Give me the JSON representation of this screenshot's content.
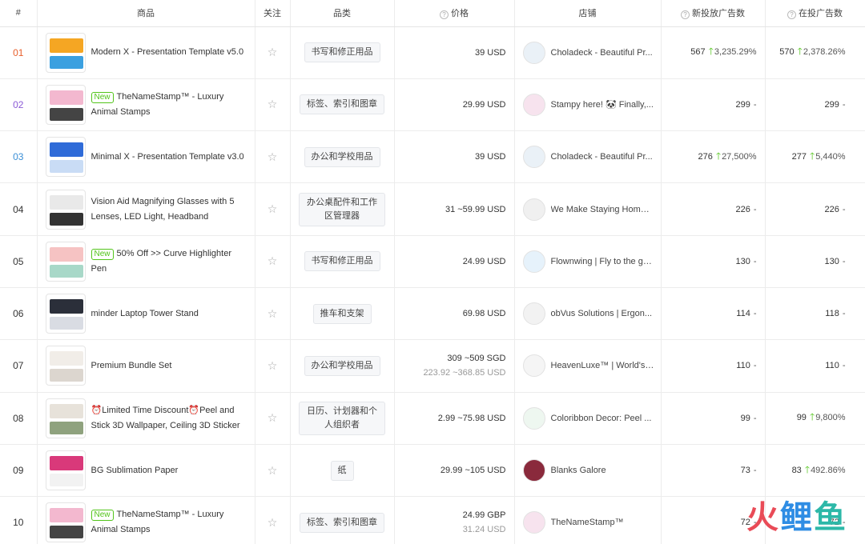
{
  "headers": {
    "rank": "#",
    "product": "商品",
    "follow": "关注",
    "category": "品类",
    "price": "价格",
    "shop": "店铺",
    "new_ads": "新投放广告数",
    "current_ads": "在投广告数"
  },
  "watermark": [
    "火",
    "鲤",
    "鱼"
  ],
  "rows": [
    {
      "rank": "01",
      "rank_color": "#e8602c",
      "new": "",
      "name": "Modern X - Presentation Template v5.0",
      "category": "书写和修正用品",
      "price": "39 USD",
      "price_sub": "",
      "shop": "Choladeck - Beautiful Pr...",
      "new_ads": "567",
      "new_ads_pct": "3,235.29%",
      "cur_ads": "570",
      "cur_ads_pct": "2,378.26%",
      "thumb": [
        "#f5a623",
        "#3ba0e0"
      ],
      "logo": "#eaf1f7"
    },
    {
      "rank": "02",
      "rank_color": "#8c5bd6",
      "new": "New",
      "name": "TheNameStamp™ - Luxury Animal Stamps",
      "category": "标签、索引和图章",
      "price": "29.99 USD",
      "price_sub": "",
      "shop": "Stampy here! 🐼 Finally,...",
      "new_ads": "299",
      "new_ads_pct": "",
      "cur_ads": "299",
      "cur_ads_pct": "",
      "thumb": [
        "#f3b8cf",
        "#444444"
      ],
      "logo": "#f7e3ee"
    },
    {
      "rank": "03",
      "rank_color": "#3b8fd6",
      "new": "",
      "name": "Minimal X - Presentation Template v3.0",
      "category": "办公和学校用品",
      "price": "39 USD",
      "price_sub": "",
      "shop": "Choladeck - Beautiful Pr...",
      "new_ads": "276",
      "new_ads_pct": "27,500%",
      "cur_ads": "277",
      "cur_ads_pct": "5,440%",
      "thumb": [
        "#2f6bd8",
        "#c9dcf5"
      ],
      "logo": "#eaf1f7"
    },
    {
      "rank": "04",
      "rank_color": "#333333",
      "new": "",
      "name": "Vision Aid Magnifying Glasses with 5 Lenses, LED Light, Headband",
      "category": "办公桌配件和工作区管理器",
      "price": "31 ~59.99 USD",
      "price_sub": "",
      "shop": "We Make Staying Home ...",
      "new_ads": "226",
      "new_ads_pct": "",
      "cur_ads": "226",
      "cur_ads_pct": "",
      "thumb": [
        "#e9e9e9",
        "#333333"
      ],
      "logo": "#f0f0f0"
    },
    {
      "rank": "05",
      "rank_color": "#333333",
      "new": "New",
      "name": "50% Off >> Curve Highlighter Pen",
      "category": "书写和修正用品",
      "price": "24.99 USD",
      "price_sub": "",
      "shop": "Flownwing | Fly to the ga...",
      "new_ads": "130",
      "new_ads_pct": "",
      "cur_ads": "130",
      "cur_ads_pct": "",
      "thumb": [
        "#f6c3c3",
        "#a8d8c8"
      ],
      "logo": "#e6f2fb"
    },
    {
      "rank": "06",
      "rank_color": "#333333",
      "new": "",
      "name": "minder Laptop Tower Stand",
      "category": "推车和支架",
      "price": "69.98 USD",
      "price_sub": "",
      "shop": "obVus Solutions | Ergon...",
      "new_ads": "114",
      "new_ads_pct": "",
      "cur_ads": "118",
      "cur_ads_pct": "",
      "thumb": [
        "#2b2f3a",
        "#d9dce3"
      ],
      "logo": "#f2f2f2"
    },
    {
      "rank": "07",
      "rank_color": "#333333",
      "new": "",
      "name": "Premium Bundle Set",
      "category": "办公和学校用品",
      "price": "309 ~509 SGD",
      "price_sub": "223.92 ~368.85 USD",
      "shop": "HeavenLuxe™ | World's ...",
      "new_ads": "110",
      "new_ads_pct": "",
      "cur_ads": "110",
      "cur_ads_pct": "",
      "thumb": [
        "#f1ede8",
        "#dcd6cf"
      ],
      "logo": "#f5f5f5"
    },
    {
      "rank": "08",
      "rank_color": "#333333",
      "new": "",
      "name": "⏰Limited Time Discount⏰Peel and Stick 3D Wallpaper, Ceiling 3D Sticker",
      "category": "日历、计划器和个人组织者",
      "price": "2.99 ~75.98 USD",
      "price_sub": "",
      "shop": "Coloribbon Decor: Peel ...",
      "new_ads": "99",
      "new_ads_pct": "",
      "cur_ads": "99",
      "cur_ads_pct": "9,800%",
      "thumb": [
        "#e7e2da",
        "#8fa27e"
      ],
      "logo": "#eef7f0"
    },
    {
      "rank": "09",
      "rank_color": "#333333",
      "new": "",
      "name": "BG Sublimation Paper",
      "category": "纸",
      "price": "29.99 ~105 USD",
      "price_sub": "",
      "shop": "Blanks Galore",
      "new_ads": "73",
      "new_ads_pct": "",
      "cur_ads": "83",
      "cur_ads_pct": "492.86%",
      "thumb": [
        "#d9397a",
        "#f2f2f2"
      ],
      "logo": "#8a2a3c"
    },
    {
      "rank": "10",
      "rank_color": "#333333",
      "new": "New",
      "name": "TheNameStamp™ - Luxury Animal Stamps",
      "category": "标签、索引和图章",
      "price": "24.99 GBP",
      "price_sub": "31.24 USD",
      "shop": "TheNameStamp™",
      "new_ads": "72",
      "new_ads_pct": "",
      "cur_ads": "72",
      "cur_ads_pct": "",
      "thumb": [
        "#f3b8cf",
        "#444444"
      ],
      "logo": "#f7e3ee"
    }
  ]
}
